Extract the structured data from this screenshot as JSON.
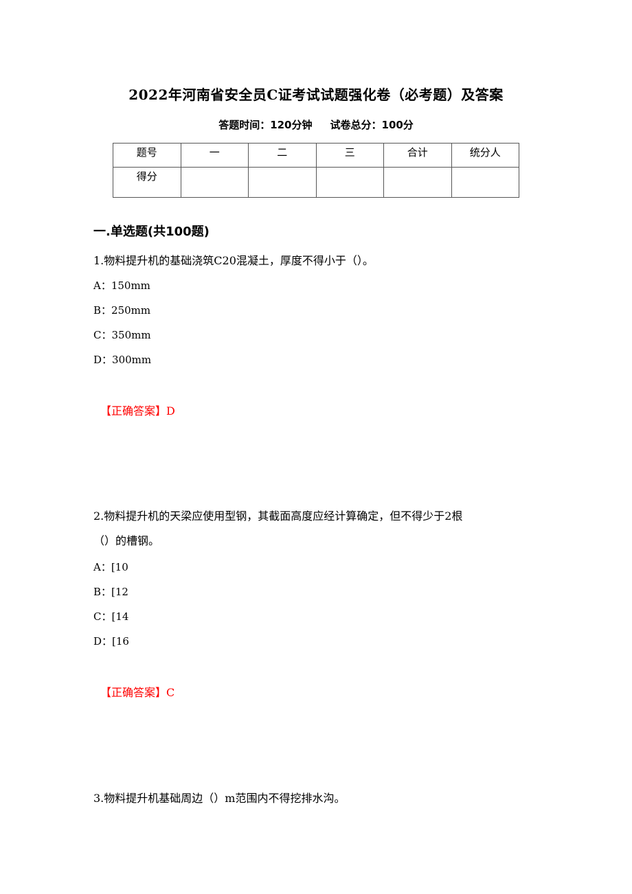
{
  "document": {
    "title": "2022年河南省安全员C证考试试题强化卷（必考题）及答案",
    "time_label": "答题时间：120分钟",
    "score_label": "试卷总分：100分"
  },
  "score_table": {
    "headers": [
      "题号",
      "一",
      "二",
      "三",
      "合计",
      "统分人"
    ],
    "row_label": "得分",
    "row_values": [
      "",
      "",
      "",
      "",
      ""
    ]
  },
  "section": {
    "title": "一.单选题(共100题)"
  },
  "questions": [
    {
      "text": "1.物料提升机的基础浇筑C20混凝土，厚度不得小于（）。",
      "options": [
        "A：150mm",
        "B：250mm",
        "C：350mm",
        "D：300mm"
      ],
      "answer": "【正确答案】D"
    },
    {
      "text_line1": "2.物料提升机的天梁应使用型钢，其截面高度应经计算确定，但不得少于2根",
      "text_line2": "（）的槽钢。",
      "options": [
        "A：[10",
        "B：[12",
        "C：[14",
        "D：[16"
      ],
      "answer": "【正确答案】C"
    },
    {
      "text": "3.物料提升机基础周边（）m范围内不得挖排水沟。"
    }
  ],
  "colors": {
    "text": "#000000",
    "answer": "#ff0000",
    "border": "#555555"
  }
}
